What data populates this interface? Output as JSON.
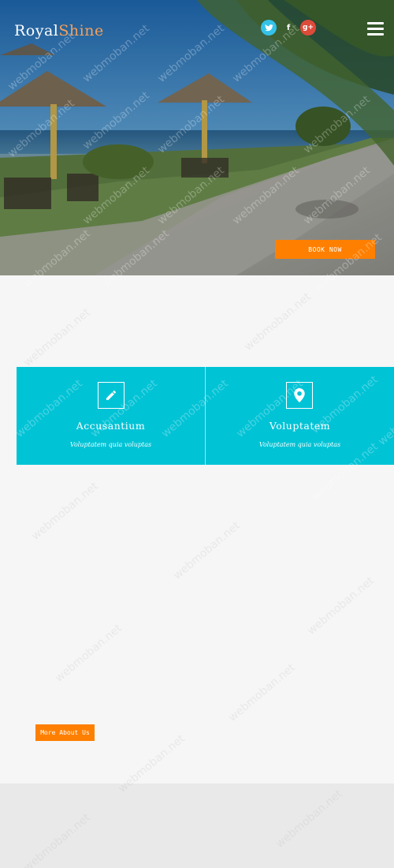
{
  "brand": {
    "part1": "Royal",
    "part2": "Shine"
  },
  "socials": [
    {
      "name": "twitter",
      "glyph": "🐦",
      "color": "#35c2e8"
    },
    {
      "name": "facebook",
      "glyph": "f",
      "color": "transparent"
    },
    {
      "name": "google-plus",
      "glyph": "g+",
      "color": "#dd4b39"
    }
  ],
  "hero": {
    "book_label": "BOOK NOW"
  },
  "features": [
    {
      "icon": "pencil-icon",
      "title": "Accusantium",
      "subtitle": "Voluptatem quia voluptas"
    },
    {
      "icon": "map-pin-icon",
      "title": "Voluptatem",
      "subtitle": "Voluptatem quia voluptas"
    }
  ],
  "about": {
    "more_label": "More About Us"
  },
  "watermark": "webmoban.net",
  "colors": {
    "accent": "#ff7f00",
    "teal": "#00c3d6",
    "brand_secondary": "#f5a05a"
  }
}
